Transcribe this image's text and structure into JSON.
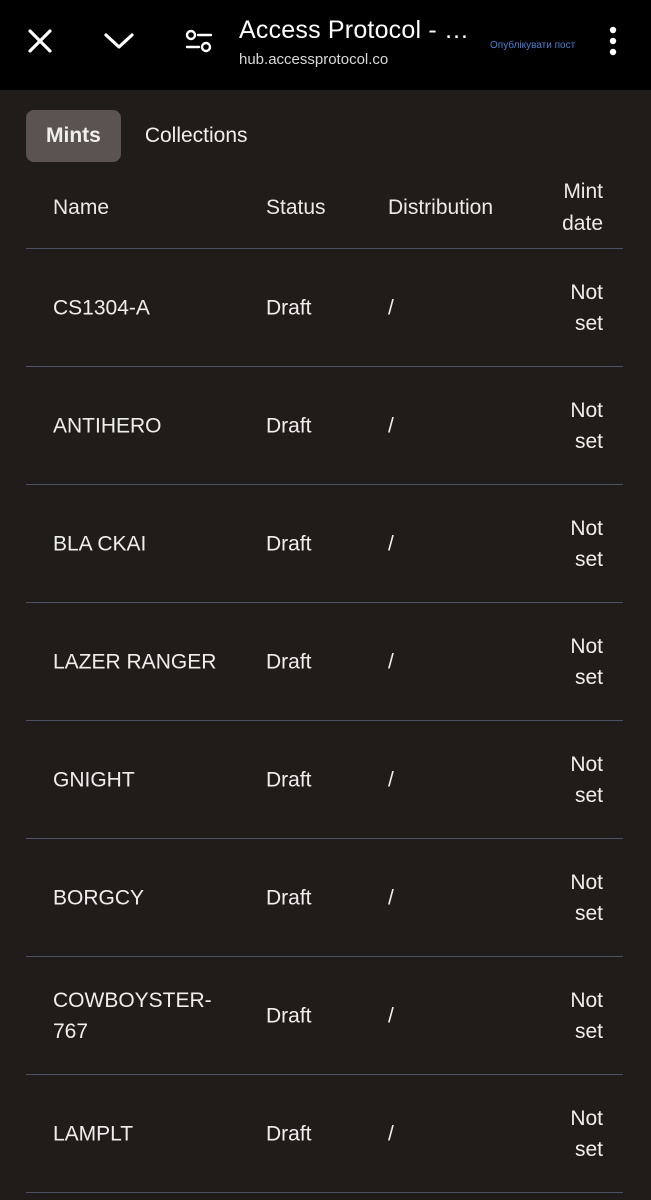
{
  "browser": {
    "title": "Access Protocol - …",
    "url": "hub.accessprotocol.co",
    "publish_label": "Опублікувати пост",
    "icons": {
      "close": "close-icon",
      "chevron": "chevron-down-icon",
      "tune": "tune-icon",
      "menu": "more-vert-icon"
    }
  },
  "tabs": [
    {
      "label": "Mints",
      "active": true
    },
    {
      "label": "Collections",
      "active": false
    }
  ],
  "table": {
    "headers": {
      "name": "Name",
      "status": "Status",
      "distribution": "Distribution",
      "mint_date_line1": "Mint",
      "mint_date_line2": "date"
    },
    "rows": [
      {
        "name": "CS1304-A",
        "status": "Draft",
        "distribution": "/",
        "mint_line1": "Not",
        "mint_line2": "set"
      },
      {
        "name": "ANTIHERO",
        "status": "Draft",
        "distribution": "/",
        "mint_line1": "Not",
        "mint_line2": "set"
      },
      {
        "name": "BLA CKAI",
        "status": "Draft",
        "distribution": "/",
        "mint_line1": "Not",
        "mint_line2": "set"
      },
      {
        "name": "LAZER RANGER",
        "status": "Draft",
        "distribution": "/",
        "mint_line1": "Not",
        "mint_line2": "set"
      },
      {
        "name": "GNIGHT",
        "status": "Draft",
        "distribution": "/",
        "mint_line1": "Not",
        "mint_line2": "set"
      },
      {
        "name": "BORGCY",
        "status": "Draft",
        "distribution": "/",
        "mint_line1": "Not",
        "mint_line2": "set"
      },
      {
        "name": "COWBOYSTER-767",
        "status": "Draft",
        "distribution": "/",
        "mint_line1": "Not",
        "mint_line2": "set"
      },
      {
        "name": "LAMPLT",
        "status": "Draft",
        "distribution": "/",
        "mint_line1": "Not",
        "mint_line2": "set"
      }
    ]
  },
  "colors": {
    "background": "#1f1c1a",
    "topbar": "#000000",
    "active_tab": "#5a5352",
    "divider": "#4a5266",
    "publish_link": "#4a7fd4"
  }
}
